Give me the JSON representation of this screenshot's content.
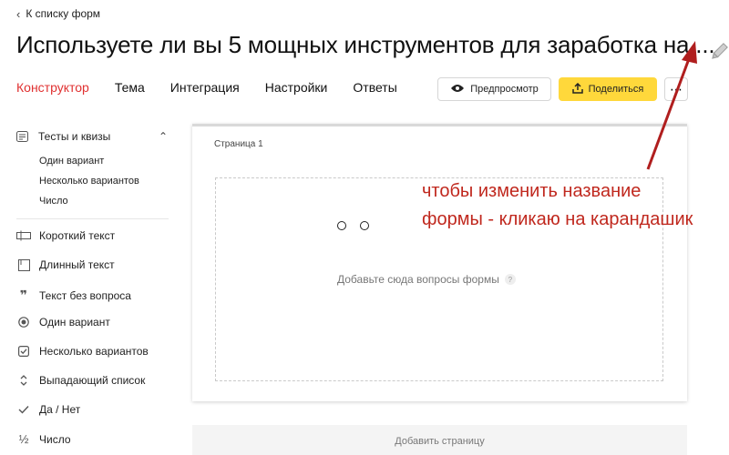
{
  "header": {
    "back_label": "К списку форм",
    "title": "Используете ли вы 5 мощных инструментов для заработка на ..."
  },
  "tabs": [
    {
      "label": "Конструктор",
      "active": true
    },
    {
      "label": "Тема",
      "active": false
    },
    {
      "label": "Интеграция",
      "active": false
    },
    {
      "label": "Настройки",
      "active": false
    },
    {
      "label": "Ответы",
      "active": false
    }
  ],
  "toolbar": {
    "preview_label": "Предпросмотр",
    "share_label": "Поделиться",
    "more_label": "⋯",
    "accent_color": "#ffd83b"
  },
  "sidebar": {
    "group": {
      "label": "Тесты и квизы",
      "items": [
        "Один вариант",
        "Несколько вариантов",
        "Число"
      ]
    },
    "items": [
      {
        "label": "Короткий текст",
        "icon": "short-text-icon"
      },
      {
        "label": "Длинный текст",
        "icon": "long-text-icon"
      },
      {
        "label": "Текст без вопроса",
        "icon": "quote-icon"
      },
      {
        "label": "Один вариант",
        "icon": "radio-icon"
      },
      {
        "label": "Несколько вариантов",
        "icon": "checkbox-icon"
      },
      {
        "label": "Выпадающий список",
        "icon": "dropdown-icon"
      },
      {
        "label": "Да / Нет",
        "icon": "check-icon"
      },
      {
        "label": "Число",
        "icon": "fraction-icon"
      }
    ]
  },
  "canvas": {
    "page_label": "Страница 1",
    "drop_hint": "Добавьте сюда вопросы формы",
    "help_mark": "?",
    "add_page_label": "Добавить страницу"
  },
  "annotation": {
    "line1": "чтобы изменить название",
    "line2": "формы - кликаю на карандашик",
    "color": "#c0281e"
  }
}
